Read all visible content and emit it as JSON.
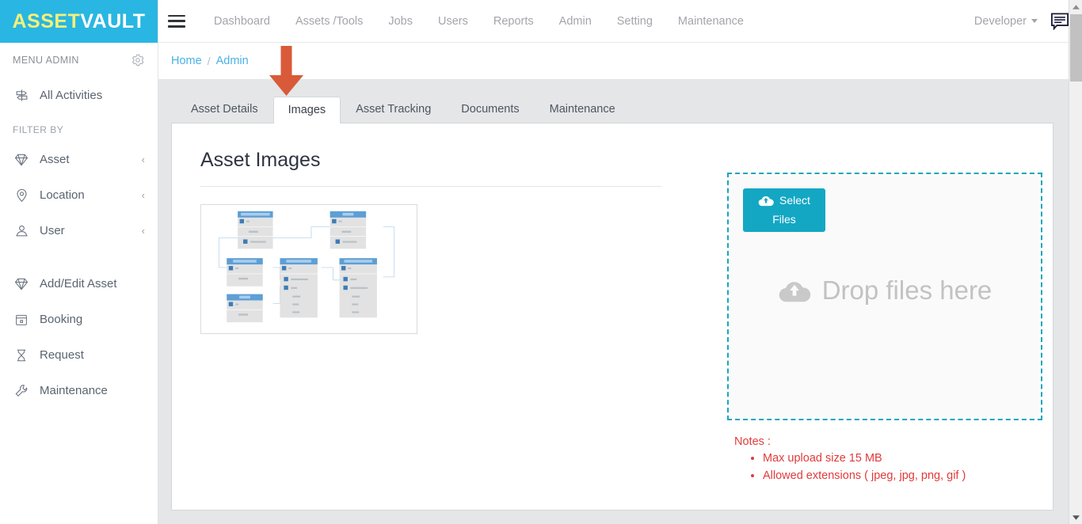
{
  "brand": {
    "part1": "ASSET",
    "part2": "VAULT",
    "bg_color": "#29b6e2",
    "part1_color": "#f5f07a"
  },
  "sidebar": {
    "menu_admin_label": "MENU ADMIN",
    "gear_icon": "gear-icon",
    "primary": [
      {
        "label": "All Activities",
        "icon": "signpost-icon"
      }
    ],
    "filter_title": "FILTER BY",
    "filters": [
      {
        "label": "Asset",
        "icon": "diamond-icon",
        "chevron": "‹"
      },
      {
        "label": "Location",
        "icon": "map-pin-icon",
        "chevron": "‹"
      },
      {
        "label": "User",
        "icon": "user-icon",
        "chevron": "‹"
      }
    ],
    "actions": [
      {
        "label": "Add/Edit Asset",
        "icon": "diamond-icon"
      },
      {
        "label": "Booking",
        "icon": "calendar-icon"
      },
      {
        "label": "Request",
        "icon": "hourglass-icon"
      },
      {
        "label": "Maintenance",
        "icon": "wrench-icon"
      }
    ]
  },
  "topnav": {
    "hamburger_icon": "hamburger-icon",
    "items": [
      {
        "label": "Dashboard"
      },
      {
        "label": "Assets /Tools"
      },
      {
        "label": "Jobs"
      },
      {
        "label": "Users"
      },
      {
        "label": "Reports"
      },
      {
        "label": "Admin"
      },
      {
        "label": "Setting"
      },
      {
        "label": "Maintenance"
      }
    ],
    "user": "Developer",
    "chat_icon": "chat-bubble-icon"
  },
  "breadcrumb": {
    "items": [
      {
        "label": "Home"
      },
      {
        "label": "Admin"
      }
    ],
    "separator": "/"
  },
  "tabs": [
    {
      "label": "Asset Details",
      "active": false
    },
    {
      "label": "Images",
      "active": true
    },
    {
      "label": "Asset Tracking",
      "active": false
    },
    {
      "label": "Documents",
      "active": false
    },
    {
      "label": "Maintenance",
      "active": false
    }
  ],
  "main": {
    "title": "Asset Images",
    "thumbnail": {
      "name": "asset-image-thumbnail",
      "alt": "database entity relationship diagram",
      "tables": [
        {
          "title": "Merchant",
          "fields": [
            "id",
            "name",
            "extra_charge"
          ]
        },
        {
          "title": "Bill",
          "fields": [
            "id",
            "name",
            "merchant"
          ]
        },
        {
          "title": "ExtraCharge",
          "fields": [
            "id",
            "name"
          ]
        },
        {
          "title": "ChargeMapping",
          "fields": [
            "id",
            "extra_charge",
            "bill",
            "price",
            "qty",
            "total"
          ]
        },
        {
          "title": "AdditionalCharge",
          "fields": [
            "id",
            "bill",
            "extra_charge",
            "price",
            "qty",
            "total"
          ]
        },
        {
          "title": "Fee",
          "fields": [
            "id",
            "name"
          ]
        }
      ]
    }
  },
  "dropzone": {
    "select_files_line1": "Select",
    "select_files_line2": "Files",
    "select_files_icon": "cloud-upload-icon",
    "drop_text": "Drop files here",
    "drop_icon": "cloud-upload-icon",
    "border_color": "#16a7bd",
    "button_color": "#13a7c4"
  },
  "notes": {
    "title": "Notes :",
    "color": "#e23a3a",
    "items": [
      "Max upload size 15 MB",
      "Allowed extensions ( jpeg, jpg, png, gif )"
    ]
  },
  "annotation": {
    "arrow": "down-arrow-annotation",
    "color": "#d95a38",
    "points_at": "Images"
  },
  "scrollbar": {
    "up_arrow": "scroll-up-arrow",
    "down_arrow": "scroll-down-arrow",
    "thumb": "scroll-thumb"
  }
}
